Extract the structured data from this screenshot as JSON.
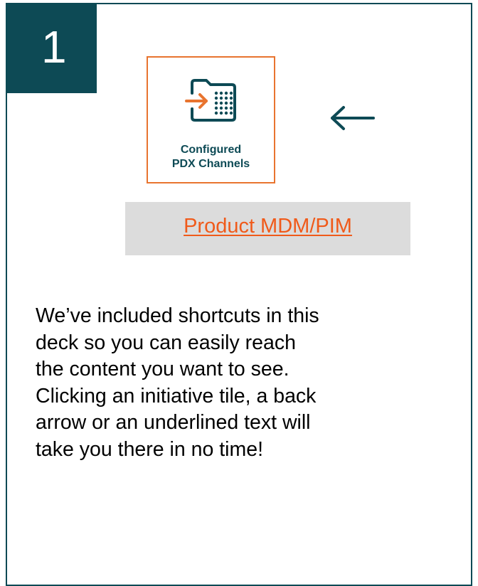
{
  "step": {
    "number": "1"
  },
  "tile": {
    "icon": "folder-import-icon",
    "label_line1": "Configured",
    "label_line2": "PDX Channels"
  },
  "navigation": {
    "back_icon": "left-arrow-icon"
  },
  "link": {
    "label": "Product MDM/PIM"
  },
  "description": {
    "lines": [
      "We’ve included shortcuts in this",
      "deck so you can easily reach",
      "the content you want to see.",
      "Clicking an initiative tile, a back",
      "arrow or an underlined text will",
      "take you there in no time!"
    ]
  },
  "colors": {
    "primary_teal": "#0d4a55",
    "accent_orange": "#e8742f",
    "link_orange": "#f05a1a",
    "link_background": "#dcdcdc"
  }
}
